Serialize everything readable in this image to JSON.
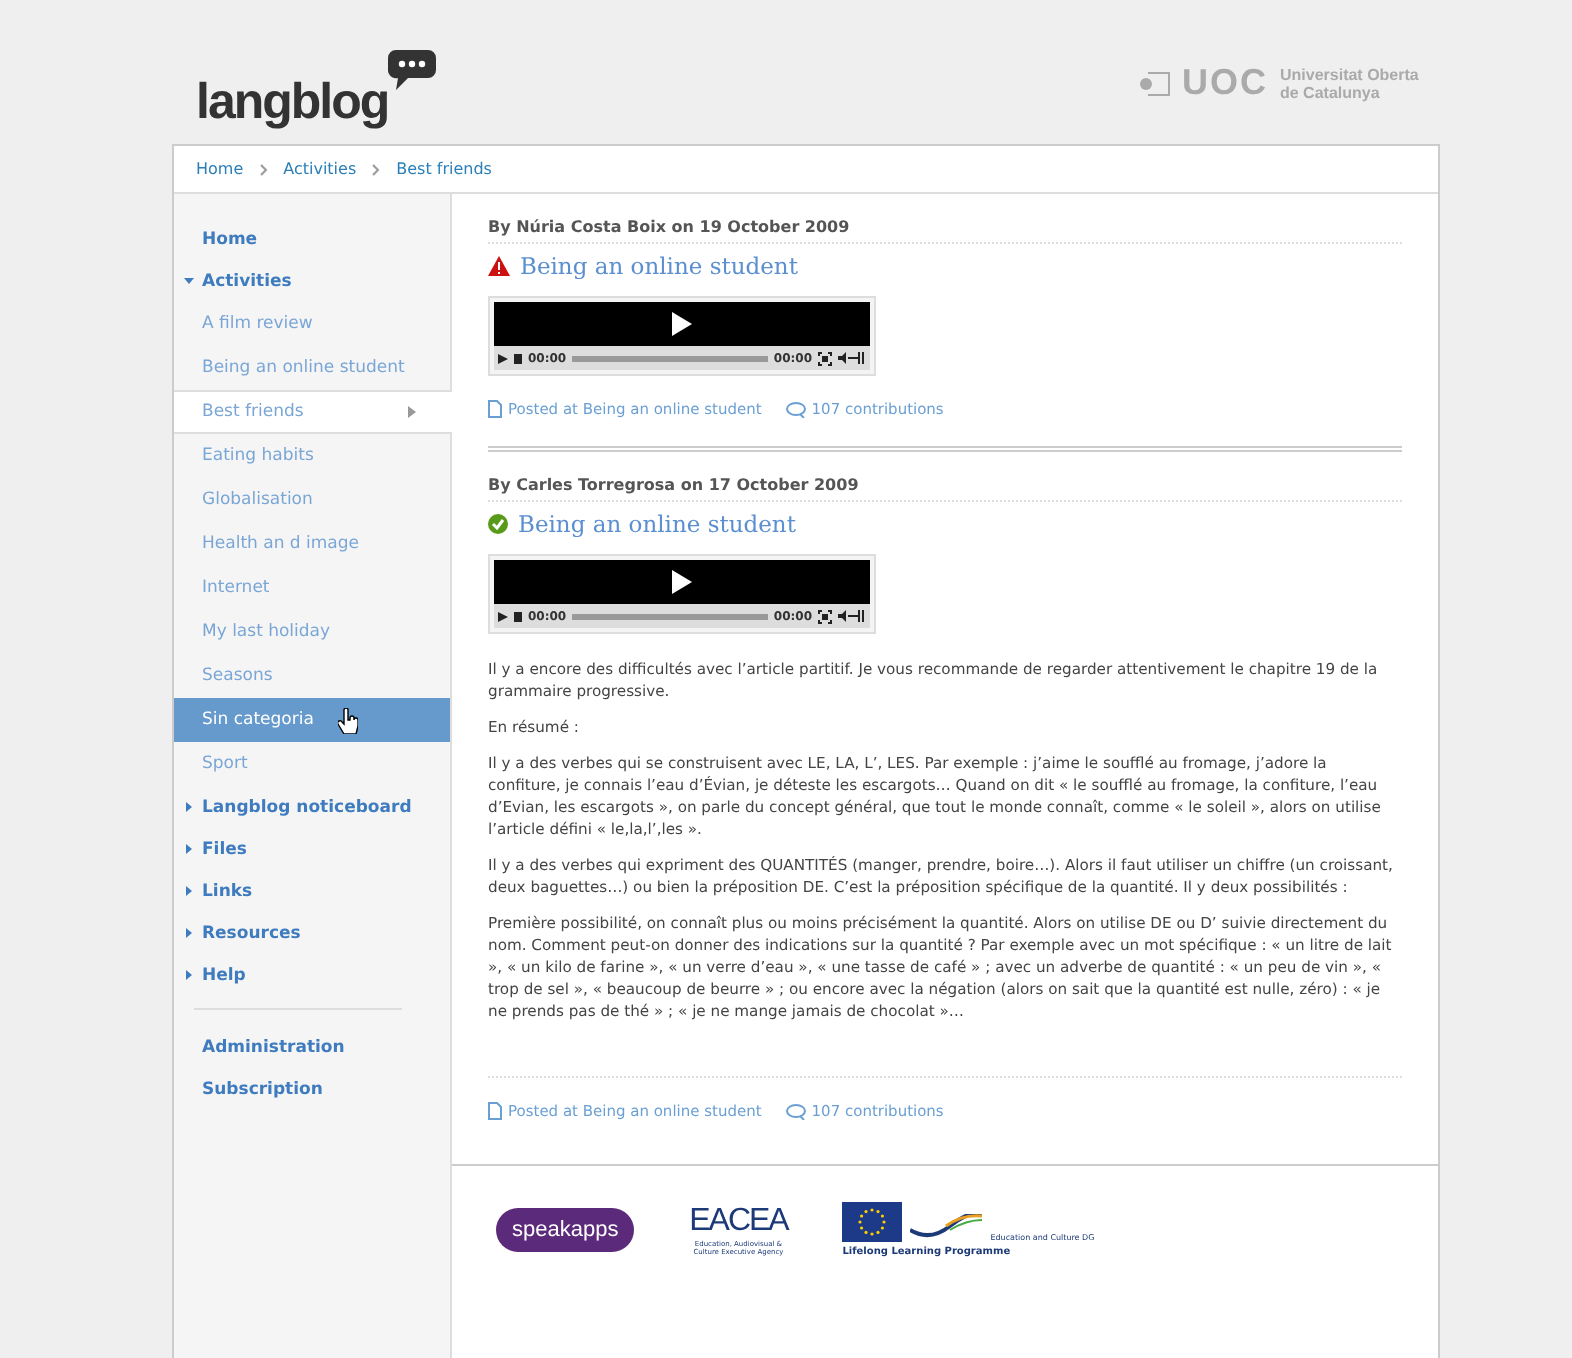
{
  "header": {
    "logo": "langblog",
    "institution_mark": "UOC",
    "institution_name": "Universitat Oberta de Catalunya"
  },
  "breadcrumb": [
    "Home",
    "Activities",
    "Best friends"
  ],
  "sidebar": {
    "items": [
      {
        "label": "Home",
        "kind": "link"
      },
      {
        "label": "Activities",
        "kind": "section",
        "expanded": true,
        "children": [
          {
            "label": "A film review",
            "selected": false,
            "hovered": false
          },
          {
            "label": "Being an online student",
            "selected": false,
            "hovered": false
          },
          {
            "label": "Best friends",
            "selected": true,
            "hovered": false
          },
          {
            "label": "Eating habits",
            "selected": false,
            "hovered": false
          },
          {
            "label": "Globalisation",
            "selected": false,
            "hovered": false
          },
          {
            "label": "Health an d image",
            "selected": false,
            "hovered": false
          },
          {
            "label": "Internet",
            "selected": false,
            "hovered": false
          },
          {
            "label": "My last holiday",
            "selected": false,
            "hovered": false
          },
          {
            "label": "Seasons",
            "selected": false,
            "hovered": false
          },
          {
            "label": "Sin categoria",
            "selected": false,
            "hovered": true
          },
          {
            "label": "Sport",
            "selected": false,
            "hovered": false
          }
        ]
      },
      {
        "label": "Langblog noticeboard",
        "kind": "section",
        "expanded": false
      },
      {
        "label": "Files",
        "kind": "section",
        "expanded": false
      },
      {
        "label": "Links",
        "kind": "section",
        "expanded": false
      },
      {
        "label": "Resources",
        "kind": "section",
        "expanded": false
      },
      {
        "label": "Help",
        "kind": "section",
        "expanded": false
      }
    ],
    "footer_links": [
      "Administration",
      "Subscription"
    ]
  },
  "posts": [
    {
      "byline": "By Núria Costa Boix on 19 October 2009",
      "kind": "warning",
      "title": "Being an online student",
      "player": {
        "elapsed": "00:00",
        "duration": "00:00"
      },
      "posted_at": "Posted at Being an online student",
      "contributions": "107 contributions"
    },
    {
      "byline": "By Carles Torregrosa on 17 October 2009",
      "kind": "approved",
      "title": "Being an online student",
      "player": {
        "elapsed": "00:00",
        "duration": "00:00"
      },
      "body": [
        "Il y a encore des difficultés avec l’article partitif. Je vous recommande de regarder attentivement le chapitre 19 de la grammaire progressive.",
        "En résumé :",
        "Il y a des verbes qui se construisent avec LE, LA, L’, LES. Par exemple : j’aime le soufflé au fromage, j’adore la confiture, je connais l’eau d’Évian, je déteste les escargots… Quand on dit « le soufflé au fromage, la confiture, l’eau d’Evian, les escargots », on parle du concept général, que tout le monde connaît, comme « le soleil », alors on utilise l’article défini « le,la,l’,les ».",
        "Il y a des verbes qui expriment des QUANTITÉS (manger, prendre, boire…). Alors il faut utiliser un chiffre (un croissant, deux baguettes…) ou bien la préposition DE. C’est la préposition spécifique de la quantité. Il y deux possibilités :",
        "Première possibilité, on connaît plus ou moins précisément la quantité. Alors on utilise DE ou D’ suivie directement du nom. Comment peut-on donner des indications sur la quantité ? Par exemple avec un mot spécifique : « un litre de lait », « un kilo de farine », « un verre d’eau », « une tasse de café » ; avec un adverbe de quantité : « un peu de vin », « trop de sel », « beaucoup de beurre » ; ou encore avec la négation (alors on sait que la quantité est nulle, zéro) : « je ne prends pas de thé » ; « je ne mange jamais de chocolat »…"
      ],
      "posted_at": "Posted at Being an online student",
      "contributions": "107 contributions"
    }
  ],
  "partners": [
    {
      "kind": "speakapps",
      "name": "speak",
      "suffix": "apps"
    },
    {
      "kind": "eacea",
      "name": "EACEA",
      "caption": "Education, Audiovisual & Culture Executive Agency"
    },
    {
      "kind": "eu",
      "name": "Education and Culture DG",
      "caption": "Lifelong Learning Programme"
    }
  ]
}
